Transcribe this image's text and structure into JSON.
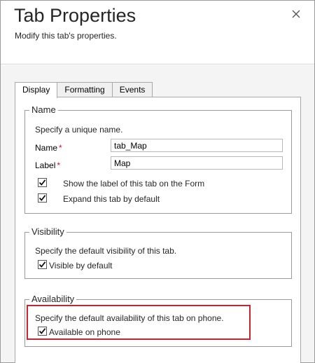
{
  "dialog": {
    "title": "Tab Properties",
    "subtitle": "Modify this tab's properties."
  },
  "tabs": [
    {
      "label": "Display",
      "active": true
    },
    {
      "label": "Formatting",
      "active": false
    },
    {
      "label": "Events",
      "active": false
    }
  ],
  "name_section": {
    "legend": "Name",
    "description": "Specify a unique name.",
    "name_label": "Name",
    "name_value": "tab_Map",
    "label_label": "Label",
    "label_value": "Map",
    "required_marker": "*",
    "show_label_text": "Show the label of this tab on the Form",
    "show_label_checked": true,
    "expand_text": "Expand this tab by default",
    "expand_checked": true
  },
  "visibility_section": {
    "legend": "Visibility",
    "description": "Specify the default visibility of this tab.",
    "visible_text": "Visible by default",
    "visible_checked": true
  },
  "availability_section": {
    "legend": "Availability",
    "description": "Specify the default availability of this tab on phone.",
    "available_text": "Available on phone",
    "available_checked": true
  },
  "colors": {
    "highlight": "#c8252f",
    "required": "#c8102e"
  },
  "icons": {
    "close": "close-icon",
    "checkbox": "checkmark-icon"
  }
}
